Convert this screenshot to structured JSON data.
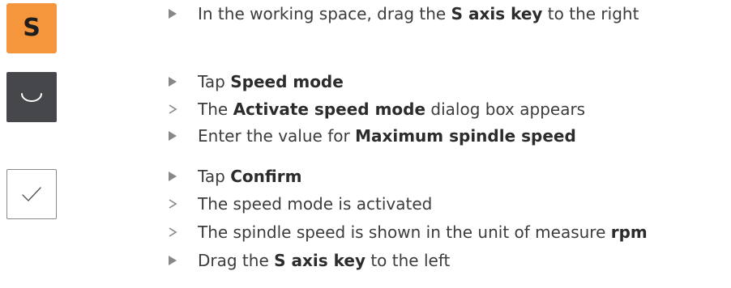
{
  "icons": {
    "s_key_label": "S"
  },
  "steps": [
    {
      "kind": "action",
      "pre": "In the working space, drag the ",
      "bold": "S axis key",
      "post": " to the right"
    },
    {
      "kind": "action",
      "pre": "Tap ",
      "bold": "Speed mode",
      "post": ""
    },
    {
      "kind": "result",
      "pre": "The ",
      "bold": "Activate speed mode",
      "post": " dialog box appears"
    },
    {
      "kind": "action",
      "pre": "Enter the value for ",
      "bold": "Maximum spindle speed",
      "post": ""
    },
    {
      "kind": "action",
      "pre": "Tap ",
      "bold": "Confirm",
      "post": ""
    },
    {
      "kind": "result",
      "pre": "The speed mode is activated",
      "bold": "",
      "post": ""
    },
    {
      "kind": "result",
      "pre": "The spindle speed is shown in the unit of measure ",
      "bold": "rpm",
      "post": ""
    },
    {
      "kind": "action",
      "pre": "Drag the ",
      "bold": "S axis key",
      "post": " to the left"
    }
  ],
  "colors": {
    "s_key": "#f5953c",
    "speed_button": "#45474a",
    "marker": "#888888",
    "text": "#3c3c3c"
  }
}
